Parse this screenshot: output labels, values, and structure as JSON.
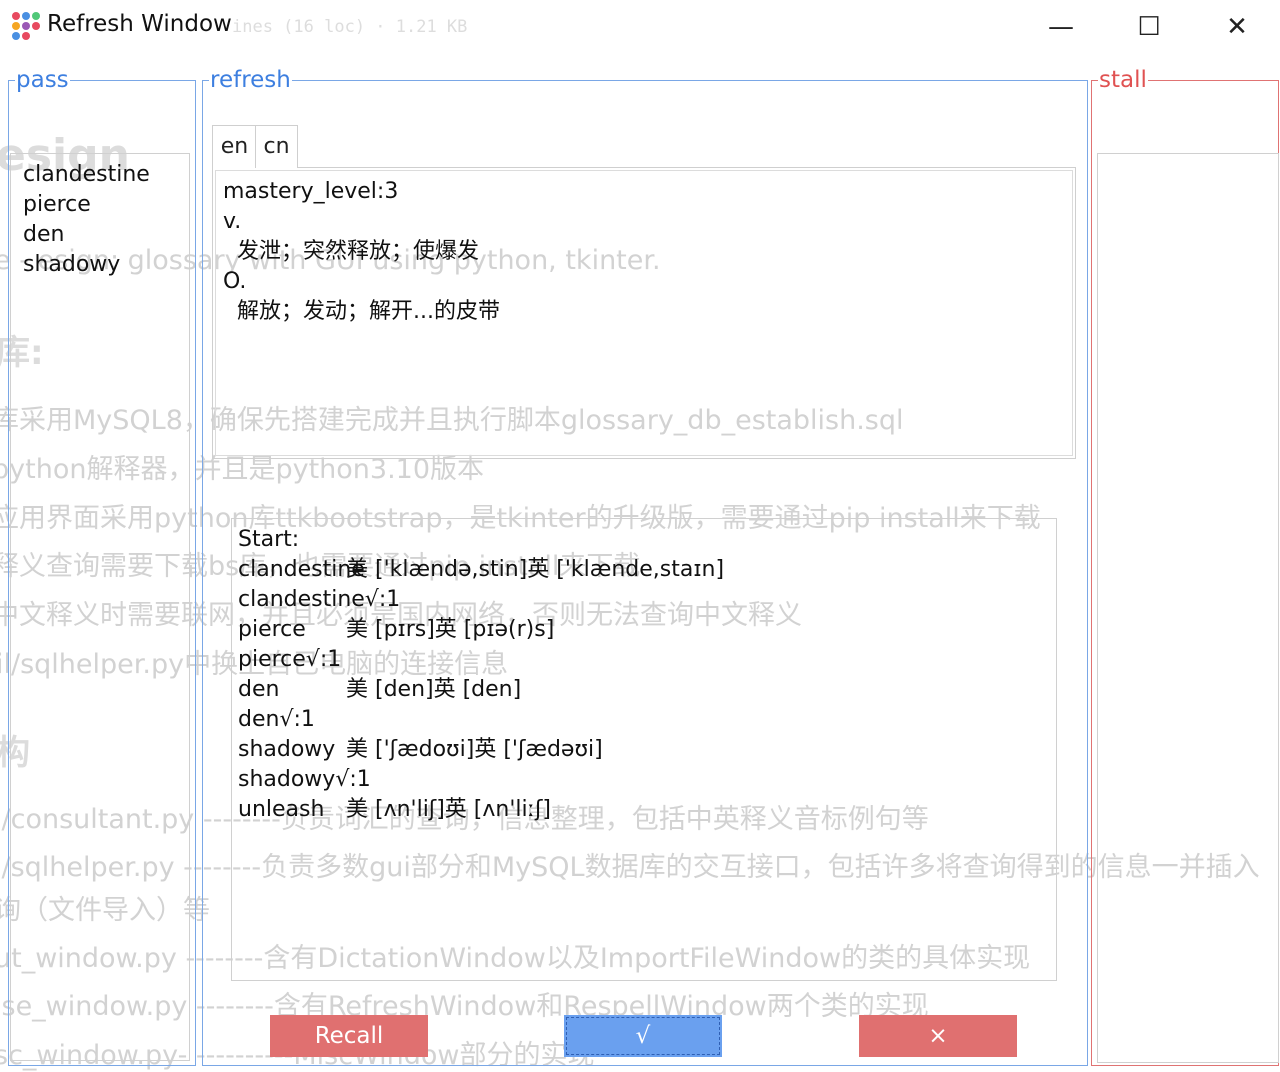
{
  "background_page": {
    "file_info": "ines (16 loc) · 1.21 KB",
    "heading": "esign",
    "intro": "e    -  esign: glossary with GUI using python, tkinter.",
    "section_db": "库:",
    "bullets": [
      "库采用MySQL8，确保先搭建完成并且执行脚本glossary_db_establish.sql",
      "python解释器，并且是python3.10版本",
      "应用界面采用python库ttkbootstrap，是tkinter的升级版，需要通过pip install来下载",
      "释义查询需要下载bs库，也需要通过pip install来下载",
      "中文释义时需要联网，并且必须是国内网络，否则无法查询中文释义",
      "il/sqlhelper.py中换上自己电脑的连接信息"
    ],
    "section_struct": "构",
    "files": [
      "i/consultant.py --------负责词汇的查询，信息整理，包括中英释义音标例句等",
      "i/sqlhelper.py --------负责多数gui部分和MySQL数据库的交互接口，包括许多将查询得到的信息一并插入",
      "询（文件导入）等",
      "ut_window.py --------含有DictationWindow以及ImportFileWindow的类的具体实现",
      "ise_window.py --------含有RefreshWindow和RespellWindow两个类的实现",
      "sc_window.py- ----------MiscWindow部分的实现"
    ]
  },
  "window": {
    "title": "Refresh Window",
    "controls": {
      "minimize": "—",
      "maximize": "☐",
      "close": "✕"
    }
  },
  "frames": {
    "pass": "pass",
    "refresh": "refresh",
    "stall": "stall"
  },
  "pass_list": [
    "clandestine",
    "pierce",
    "den",
    "shadowy"
  ],
  "tabs": [
    "en",
    "cn"
  ],
  "definition": {
    "lines": [
      "mastery_level:3",
      "v.",
      "  发泄；突然释放；使爆发",
      "O.",
      "  解放；发动；解开...的皮带"
    ]
  },
  "output": {
    "header": "Start:",
    "lines": [
      {
        "word": "clandestine",
        "phon": "美 ['klændə,stin]英 ['klænde,staɪn]"
      },
      {
        "word": "clandestine√:1",
        "phon": ""
      },
      {
        "word": "pierce",
        "phon": "美 [pɪrs]英 [pɪə(r)s]"
      },
      {
        "word": "pierce√:1",
        "phon": ""
      },
      {
        "word": "den",
        "phon": "美 [den]英 [den]"
      },
      {
        "word": "den√:1",
        "phon": ""
      },
      {
        "word": "shadowy",
        "phon": "美 ['ʃædoʊi]英 ['ʃædəʊi]"
      },
      {
        "word": "shadowy√:1",
        "phon": ""
      },
      {
        "word": "unleash",
        "phon": "美 [ʌn'liʃ]英 [ʌn'liːʃ]"
      }
    ]
  },
  "buttons": {
    "recall": "Recall",
    "correct": "√",
    "wrong": "×"
  },
  "colors": {
    "blue_frame": "#7aa7e6",
    "red_frame": "#e07373",
    "danger_button": "#e07070",
    "primary_button": "#6aa0ef"
  }
}
